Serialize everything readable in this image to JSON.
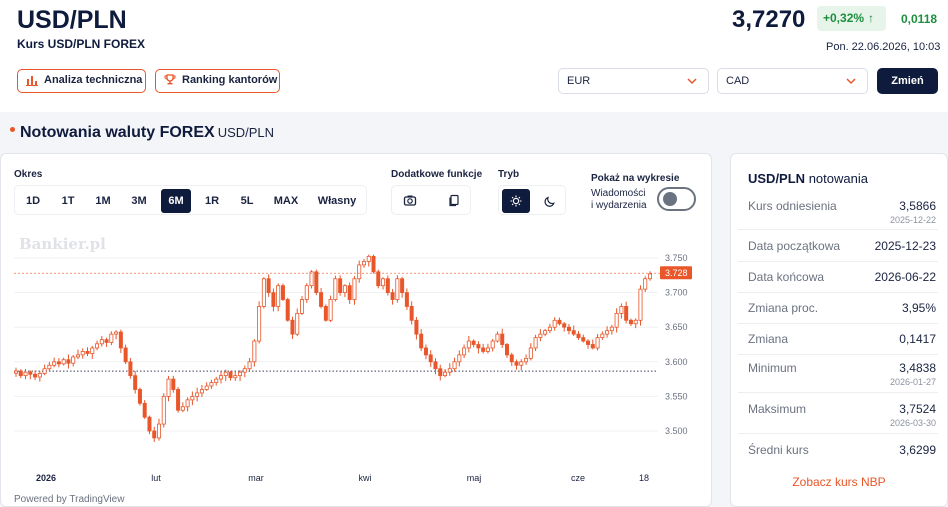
{
  "header": {
    "title": "USD/PLN",
    "subtitle": "Kurs USD/PLN FOREX",
    "price": "3,7270",
    "change_pct": "+0,32%",
    "change_abs": "0,0118",
    "datetime": "Pon. 22.06.2026, 10:03",
    "btn_technical": "Analiza techniczna",
    "btn_ranking": "Ranking kantorów",
    "select_from": "EUR",
    "select_to": "CAD",
    "btn_change": "Zmień"
  },
  "section": {
    "title": "Notowania waluty FOREX",
    "subtitle": "USD/PLN"
  },
  "controls": {
    "period_label": "Okres",
    "periods": [
      "1D",
      "1T",
      "1M",
      "3M",
      "6M",
      "1R",
      "5L",
      "MAX",
      "Własny"
    ],
    "active_period": "6M",
    "extra_label": "Dodatkowe funkcje",
    "mode_label": "Tryb",
    "show_label": "Pokaż na wykresie",
    "news_label_1": "Wiadomości",
    "news_label_2": "i wydarzenia"
  },
  "chart_watermark": "Bankier.pl",
  "powered_by": "Powered by TradingView",
  "chart_data": {
    "type": "candlestick",
    "x_ticks": [
      "2026",
      "lut",
      "mar",
      "kwi",
      "maj",
      "cze",
      "18"
    ],
    "y_ticks": [
      "3.750",
      "3.700",
      "3.650",
      "3.600",
      "3.550",
      "3.500"
    ],
    "ylim": [
      3.48,
      3.765
    ],
    "last_price_label": "3.728",
    "last_price": 3.728,
    "reference_line": 3.5866,
    "closes": [
      3.5866,
      3.58,
      3.585,
      3.582,
      3.578,
      3.583,
      3.59,
      3.595,
      3.6,
      3.597,
      3.603,
      3.598,
      3.607,
      3.61,
      3.615,
      3.612,
      3.62,
      3.626,
      3.632,
      3.628,
      3.64,
      3.643,
      3.62,
      3.6,
      3.58,
      3.56,
      3.54,
      3.52,
      3.5,
      3.49,
      3.51,
      3.55,
      3.575,
      3.56,
      3.53,
      3.535,
      3.545,
      3.55,
      3.555,
      3.56,
      3.565,
      3.57,
      3.575,
      3.58,
      3.585,
      3.577,
      3.58,
      3.585,
      3.59,
      3.6,
      3.63,
      3.68,
      3.72,
      3.7,
      3.68,
      3.71,
      3.69,
      3.66,
      3.64,
      3.67,
      3.69,
      3.71,
      3.73,
      3.7,
      3.68,
      3.66,
      3.69,
      3.72,
      3.7,
      3.71,
      3.69,
      3.72,
      3.74,
      3.745,
      3.7524,
      3.73,
      3.71,
      3.72,
      3.7,
      3.69,
      3.72,
      3.7,
      3.68,
      3.66,
      3.64,
      3.62,
      3.61,
      3.6,
      3.59,
      3.58,
      3.585,
      3.59,
      3.6,
      3.61,
      3.62,
      3.63,
      3.625,
      3.62,
      3.615,
      3.62,
      3.63,
      3.64,
      3.625,
      3.61,
      3.6,
      3.595,
      3.6,
      3.605,
      3.62,
      3.635,
      3.64,
      3.645,
      3.65,
      3.66,
      3.655,
      3.65,
      3.645,
      3.64,
      3.635,
      3.63,
      3.625,
      3.62,
      3.635,
      3.64,
      3.645,
      3.65,
      3.67,
      3.68,
      3.66,
      3.655,
      3.66,
      3.705,
      3.72,
      3.727
    ]
  },
  "sidebar": {
    "title": "USD/PLN",
    "title_suffix": "notowania",
    "rows": [
      {
        "label": "Kurs odniesienia",
        "value": "3,5866",
        "date": "2025-12-22"
      },
      {
        "label": "Data początkowa",
        "value": "2025-12-23",
        "date": ""
      },
      {
        "label": "Data końcowa",
        "value": "2026-06-22",
        "date": ""
      },
      {
        "label": "Zmiana proc.",
        "value": "3,95%",
        "date": ""
      },
      {
        "label": "Zmiana",
        "value": "0,1417",
        "date": ""
      },
      {
        "label": "Minimum",
        "value": "3,4838",
        "date": "2026-01-27"
      },
      {
        "label": "Maksimum",
        "value": "3,7524",
        "date": "2026-03-30"
      },
      {
        "label": "Średni kurs",
        "value": "3,6299",
        "date": ""
      }
    ],
    "nbp_link": "Zobacz kurs NBP"
  },
  "colors": {
    "accent": "#e8562a",
    "navy": "#0f1b3d",
    "positive": "#1e8e3e"
  }
}
